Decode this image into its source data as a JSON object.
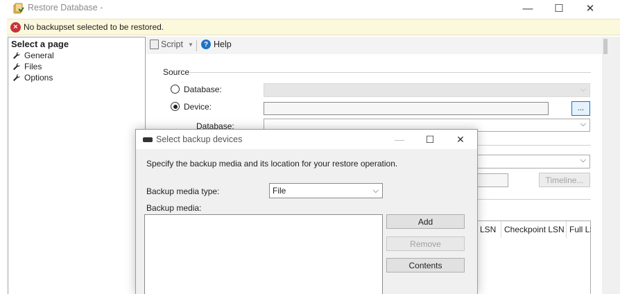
{
  "window": {
    "title": "Restore Database -",
    "controls": {
      "minimize": "—",
      "maximize": "☐",
      "close": "✕"
    }
  },
  "error_bar": {
    "icon": "error-icon",
    "message": "No backupset selected to be restored."
  },
  "left_panel": {
    "heading": "Select a page",
    "items": [
      {
        "label": "General",
        "icon": "wrench-icon",
        "selected": true
      },
      {
        "label": "Files",
        "icon": "wrench-icon"
      },
      {
        "label": "Options",
        "icon": "wrench-icon"
      }
    ]
  },
  "toolbar": {
    "script_label": "Script",
    "help_label": "Help"
  },
  "source": {
    "section_label": "Source",
    "database_radio_label": "Database:",
    "device_radio_label": "Device:",
    "selected": "Device",
    "browse_label": "...",
    "database_label": "Database:"
  },
  "destination": {
    "timeline_label": "Timeline..."
  },
  "grid": {
    "columns": [
      "LSN",
      "Checkpoint LSN",
      "Full LS"
    ]
  },
  "dialog": {
    "title": "Select backup devices",
    "description": "Specify the backup media and its location for your restore operation.",
    "media_type_label": "Backup media type:",
    "media_type_value": "File",
    "backup_media_label": "Backup media:",
    "buttons": {
      "add": "Add",
      "remove": "Remove",
      "contents": "Contents"
    },
    "controls": {
      "minimize": "—",
      "maximize": "☐",
      "close": "✕"
    }
  },
  "colors": {
    "error_bar_bg": "#fbf8dc",
    "error_icon": "#c8323a",
    "help_icon": "#1e74c8",
    "focus_border": "#0078d7"
  }
}
